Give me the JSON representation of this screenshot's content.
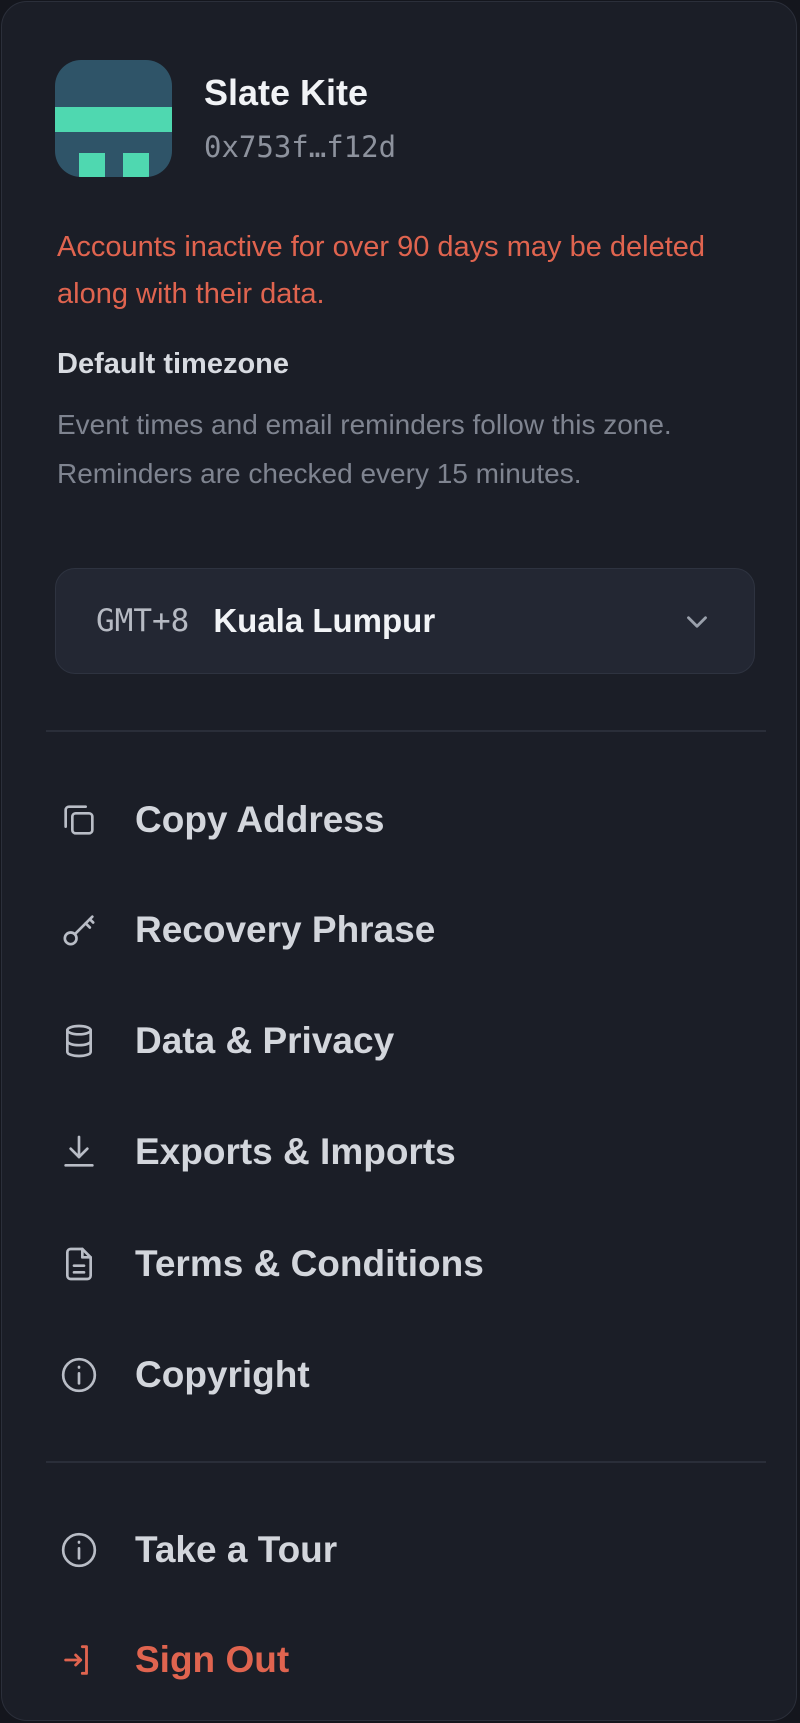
{
  "account": {
    "name": "Slate Kite",
    "address": "0x753f…f12d"
  },
  "warning": "Accounts inactive for over 90 days may be deleted along with their data.",
  "timezone": {
    "title": "Default timezone",
    "description": "Event times and email reminders follow this zone. Reminders are checked every 15 minutes.",
    "offset": "GMT+8",
    "city": "Kuala Lumpur"
  },
  "menu": {
    "primary": [
      {
        "label": "Copy Address",
        "icon": "copy-icon"
      },
      {
        "label": "Recovery Phrase",
        "icon": "key-icon"
      },
      {
        "label": "Data & Privacy",
        "icon": "database-icon"
      },
      {
        "label": "Exports & Imports",
        "icon": "download-icon"
      },
      {
        "label": "Terms & Conditions",
        "icon": "document-icon"
      },
      {
        "label": "Copyright",
        "icon": "info-icon"
      }
    ],
    "secondary": [
      {
        "label": "Take a Tour",
        "icon": "info-icon"
      },
      {
        "label": "Sign Out",
        "icon": "sign-out-icon"
      }
    ]
  },
  "colors": {
    "background": "#1b1e27",
    "danger": "#e0644f",
    "avatar_base": "#2f5468",
    "avatar_accent": "#4fd8b0"
  }
}
